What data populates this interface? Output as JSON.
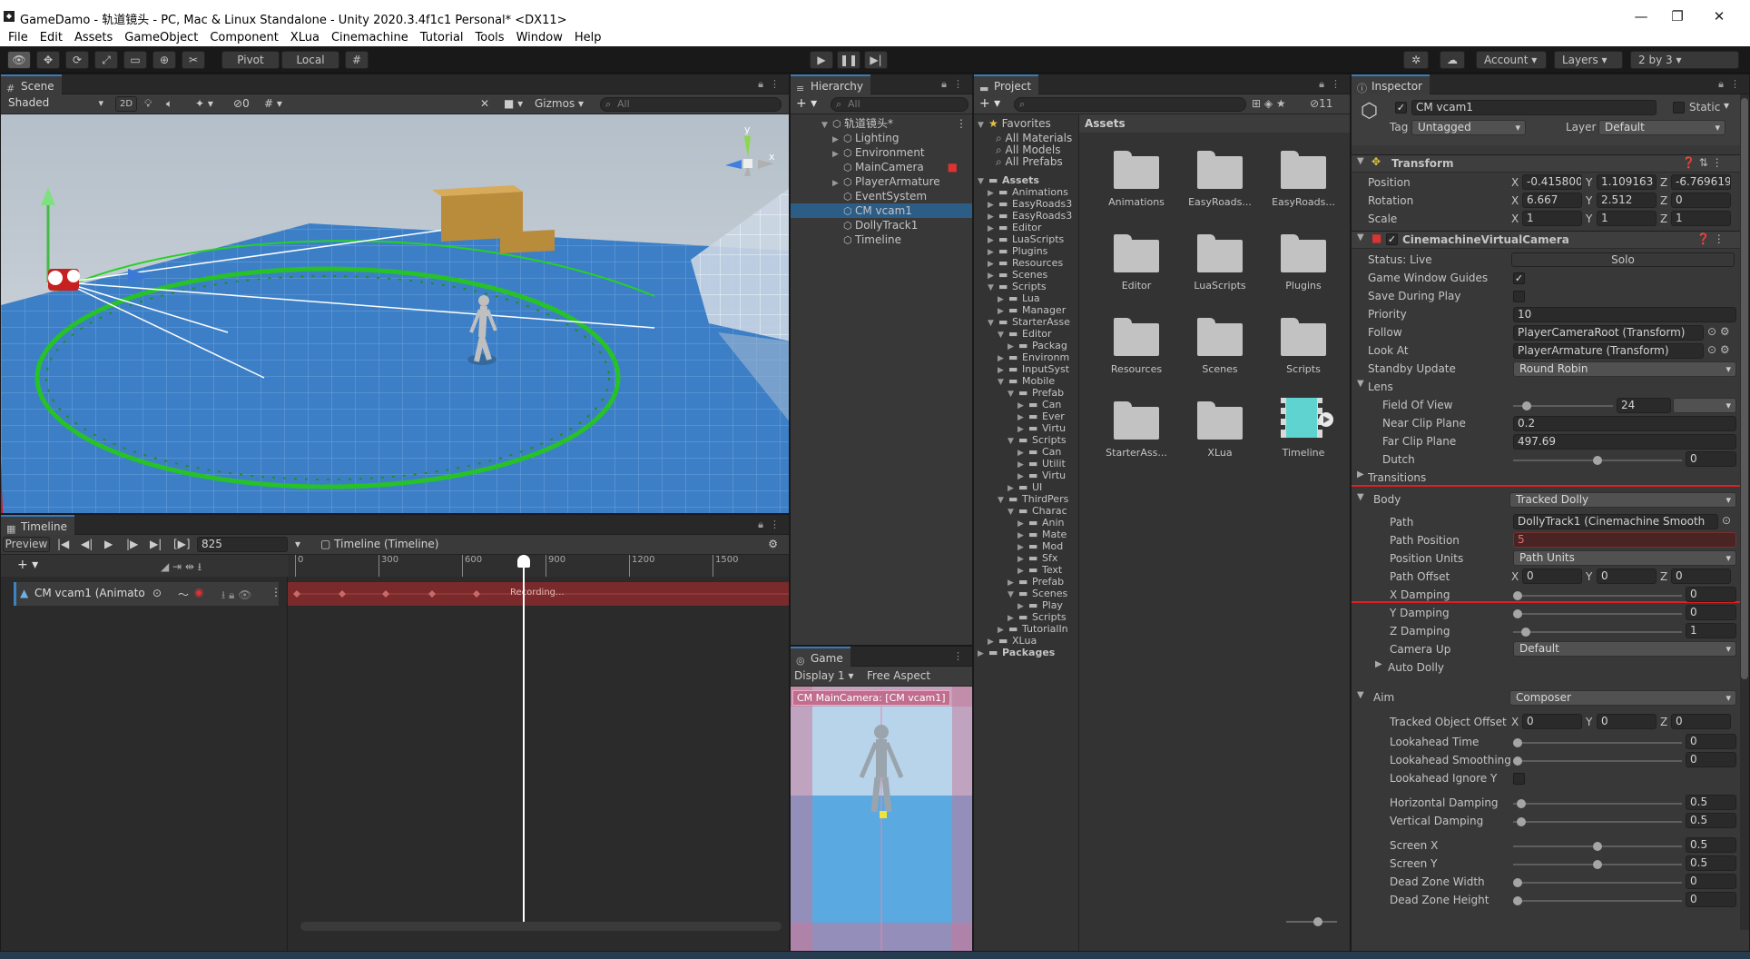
{
  "window": {
    "title": "GameDamo - 轨道镜头 - PC, Mac & Linux Standalone - Unity 2020.3.4f1c1 Personal* <DX11>"
  },
  "menu": [
    "File",
    "Edit",
    "Assets",
    "GameObject",
    "Component",
    "XLua",
    "Cinemachine",
    "Tutorial",
    "Tools",
    "Window",
    "Help"
  ],
  "toolbar": {
    "pivot": "Pivot",
    "local": "Local",
    "account": "Account",
    "layers": "Layers",
    "layout": "2 by 3"
  },
  "scene": {
    "tab": "Scene",
    "shading": "Shaded",
    "mode2d": "2D",
    "hidden_count": "0",
    "gizmos": "Gizmos",
    "search_placeholder": "All",
    "gizmo_y": "y",
    "gizmo_x": "x"
  },
  "hierarchy": {
    "tab": "Hierarchy",
    "search_placeholder": "All",
    "root": "轨道镜头*",
    "items": [
      {
        "label": "Lighting",
        "arrow": true,
        "selected": false
      },
      {
        "label": "Environment",
        "arrow": true,
        "selected": false
      },
      {
        "label": "MainCamera",
        "arrow": false,
        "selected": false
      },
      {
        "label": "PlayerArmature",
        "arrow": true,
        "selected": false
      },
      {
        "label": "EventSystem",
        "arrow": false,
        "selected": false
      },
      {
        "label": "CM vcam1",
        "arrow": false,
        "selected": true
      },
      {
        "label": "DollyTrack1",
        "arrow": false,
        "selected": false
      },
      {
        "label": "Timeline",
        "arrow": false,
        "selected": false
      }
    ]
  },
  "project": {
    "tab": "Project",
    "hidden_count": "11",
    "favorites_label": "Favorites",
    "favorites": [
      "All Materials",
      "All Models",
      "All Prefabs"
    ],
    "assets_header": "Assets",
    "tree": [
      {
        "label": "Assets",
        "depth": 0,
        "open": true
      },
      {
        "label": "Animations",
        "depth": 1,
        "open": false
      },
      {
        "label": "EasyRoads3",
        "depth": 1,
        "open": false
      },
      {
        "label": "EasyRoads3",
        "depth": 1,
        "open": false
      },
      {
        "label": "Editor",
        "depth": 1,
        "open": false
      },
      {
        "label": "LuaScripts",
        "depth": 1,
        "open": false
      },
      {
        "label": "Plugins",
        "depth": 1,
        "open": false
      },
      {
        "label": "Resources",
        "depth": 1,
        "open": false
      },
      {
        "label": "Scenes",
        "depth": 1,
        "open": false
      },
      {
        "label": "Scripts",
        "depth": 1,
        "open": true
      },
      {
        "label": "Lua",
        "depth": 2,
        "open": false
      },
      {
        "label": "Manager",
        "depth": 2,
        "open": false
      },
      {
        "label": "StarterAsse",
        "depth": 1,
        "open": true
      },
      {
        "label": "Editor",
        "depth": 2,
        "open": true
      },
      {
        "label": "Packag",
        "depth": 3,
        "open": false
      },
      {
        "label": "Environm",
        "depth": 2,
        "open": false
      },
      {
        "label": "InputSyst",
        "depth": 2,
        "open": false
      },
      {
        "label": "Mobile",
        "depth": 2,
        "open": true
      },
      {
        "label": "Prefab",
        "depth": 3,
        "open": true
      },
      {
        "label": "Can",
        "depth": 4,
        "open": false
      },
      {
        "label": "Ever",
        "depth": 4,
        "open": false
      },
      {
        "label": "Virtu",
        "depth": 4,
        "open": false
      },
      {
        "label": "Scripts",
        "depth": 3,
        "open": true
      },
      {
        "label": "Can",
        "depth": 4,
        "open": false
      },
      {
        "label": "Utilit",
        "depth": 4,
        "open": false
      },
      {
        "label": "Virtu",
        "depth": 4,
        "open": false
      },
      {
        "label": "UI",
        "depth": 3,
        "open": false
      },
      {
        "label": "ThirdPers",
        "depth": 2,
        "open": true
      },
      {
        "label": "Charac",
        "depth": 3,
        "open": true
      },
      {
        "label": "Anin",
        "depth": 4,
        "open": false
      },
      {
        "label": "Mate",
        "depth": 4,
        "open": false
      },
      {
        "label": "Mod",
        "depth": 4,
        "open": false
      },
      {
        "label": "Sfx",
        "depth": 4,
        "open": false
      },
      {
        "label": "Text",
        "depth": 4,
        "open": false
      },
      {
        "label": "Prefab",
        "depth": 3,
        "open": false
      },
      {
        "label": "Scenes",
        "depth": 3,
        "open": true
      },
      {
        "label": "Play",
        "depth": 4,
        "open": false
      },
      {
        "label": "Scripts",
        "depth": 3,
        "open": false
      },
      {
        "label": "TutorialIn",
        "depth": 2,
        "open": false
      },
      {
        "label": "XLua",
        "depth": 1,
        "open": false
      },
      {
        "label": "Packages",
        "depth": 0,
        "open": false
      }
    ],
    "grid": [
      "Animations",
      "EasyRoads...",
      "EasyRoads...",
      "Editor",
      "LuaScripts",
      "Plugins",
      "Resources",
      "Scenes",
      "Scripts",
      "StarterAss...",
      "XLua",
      "Timeline"
    ]
  },
  "game": {
    "tab": "Game",
    "display": "Display 1",
    "aspect": "Free Aspect",
    "overlay": "CM MainCamera: [CM vcam1]"
  },
  "timeline": {
    "tab": "Timeline",
    "preview": "Preview",
    "frame": "825",
    "asset": "Timeline (Timeline)",
    "ruler": [
      "0",
      "300",
      "600",
      "900",
      "1200",
      "1500"
    ],
    "track_name": "CM vcam1 (Animato",
    "recording": "Recording..."
  },
  "inspector": {
    "tab": "Inspector",
    "object_name": "CM vcam1",
    "static_label": "Static",
    "tag_label": "Tag",
    "tag_value": "Untagged",
    "layer_label": "Layer",
    "layer_value": "Default",
    "transform": {
      "title": "Transform",
      "position_label": "Position",
      "position": [
        "-0.415800",
        "1.109163",
        "-6.769619"
      ],
      "rotation_label": "Rotation",
      "rotation": [
        "6.667",
        "2.512",
        "0"
      ],
      "scale_label": "Scale",
      "scale": [
        "1",
        "1",
        "1"
      ]
    },
    "vcam": {
      "title": "CinemachineVirtualCamera",
      "status_label": "Status: Live",
      "solo": "Solo",
      "guides_label": "Game Window Guides",
      "save_label": "Save During Play",
      "priority_label": "Priority",
      "priority": "10",
      "follow_label": "Follow",
      "follow": "PlayerCameraRoot (Transform)",
      "lookat_label": "Look At",
      "lookat": "PlayerArmature (Transform)",
      "standby_label": "Standby Update",
      "standby": "Round Robin",
      "lens_label": "Lens",
      "fov_label": "Field Of View",
      "fov": "24",
      "near_label": "Near Clip Plane",
      "near": "0.2",
      "far_label": "Far Clip Plane",
      "far": "497.69",
      "dutch_label": "Dutch",
      "dutch": "0",
      "transitions_label": "Transitions",
      "body_label": "Body",
      "body": "Tracked Dolly",
      "path_label": "Path",
      "path": "DollyTrack1 (Cinemachine Smooth",
      "path_position_label": "Path Position",
      "path_position": "5",
      "position_units_label": "Position Units",
      "position_units": "Path Units",
      "path_offset_label": "Path Offset",
      "path_offset": [
        "0",
        "0",
        "0"
      ],
      "xdamp_label": "X Damping",
      "xdamp": "0",
      "ydamp_label": "Y Damping",
      "ydamp": "0",
      "zdamp_label": "Z Damping",
      "zdamp": "1",
      "camup_label": "Camera Up",
      "camup": "Default",
      "autodolly_label": "Auto Dolly",
      "aim_label": "Aim",
      "aim": "Composer",
      "tracked_offset_label": "Tracked Object Offset",
      "tracked_offset": [
        "0",
        "0",
        "0"
      ],
      "lookahead_time_label": "Lookahead Time",
      "lookahead_time": "0",
      "lookahead_smooth_label": "Lookahead Smoothing",
      "lookahead_smooth": "0",
      "lookahead_ignore_label": "Lookahead Ignore Y",
      "hdamp_label": "Horizontal Damping",
      "hdamp": "0.5",
      "vdamp_label": "Vertical Damping",
      "vdamp": "0.5",
      "screenx_label": "Screen X",
      "screenx": "0.5",
      "screeny_label": "Screen Y",
      "screeny": "0.5",
      "dzw_label": "Dead Zone Width",
      "dzw": "0",
      "dzh_label": "Dead Zone Height",
      "dzh": "0"
    }
  },
  "colors": {
    "selection": "#2c5d87",
    "highlight_box": "#e02020",
    "recording": "#7a2a2a",
    "panel_bg": "#383838"
  }
}
